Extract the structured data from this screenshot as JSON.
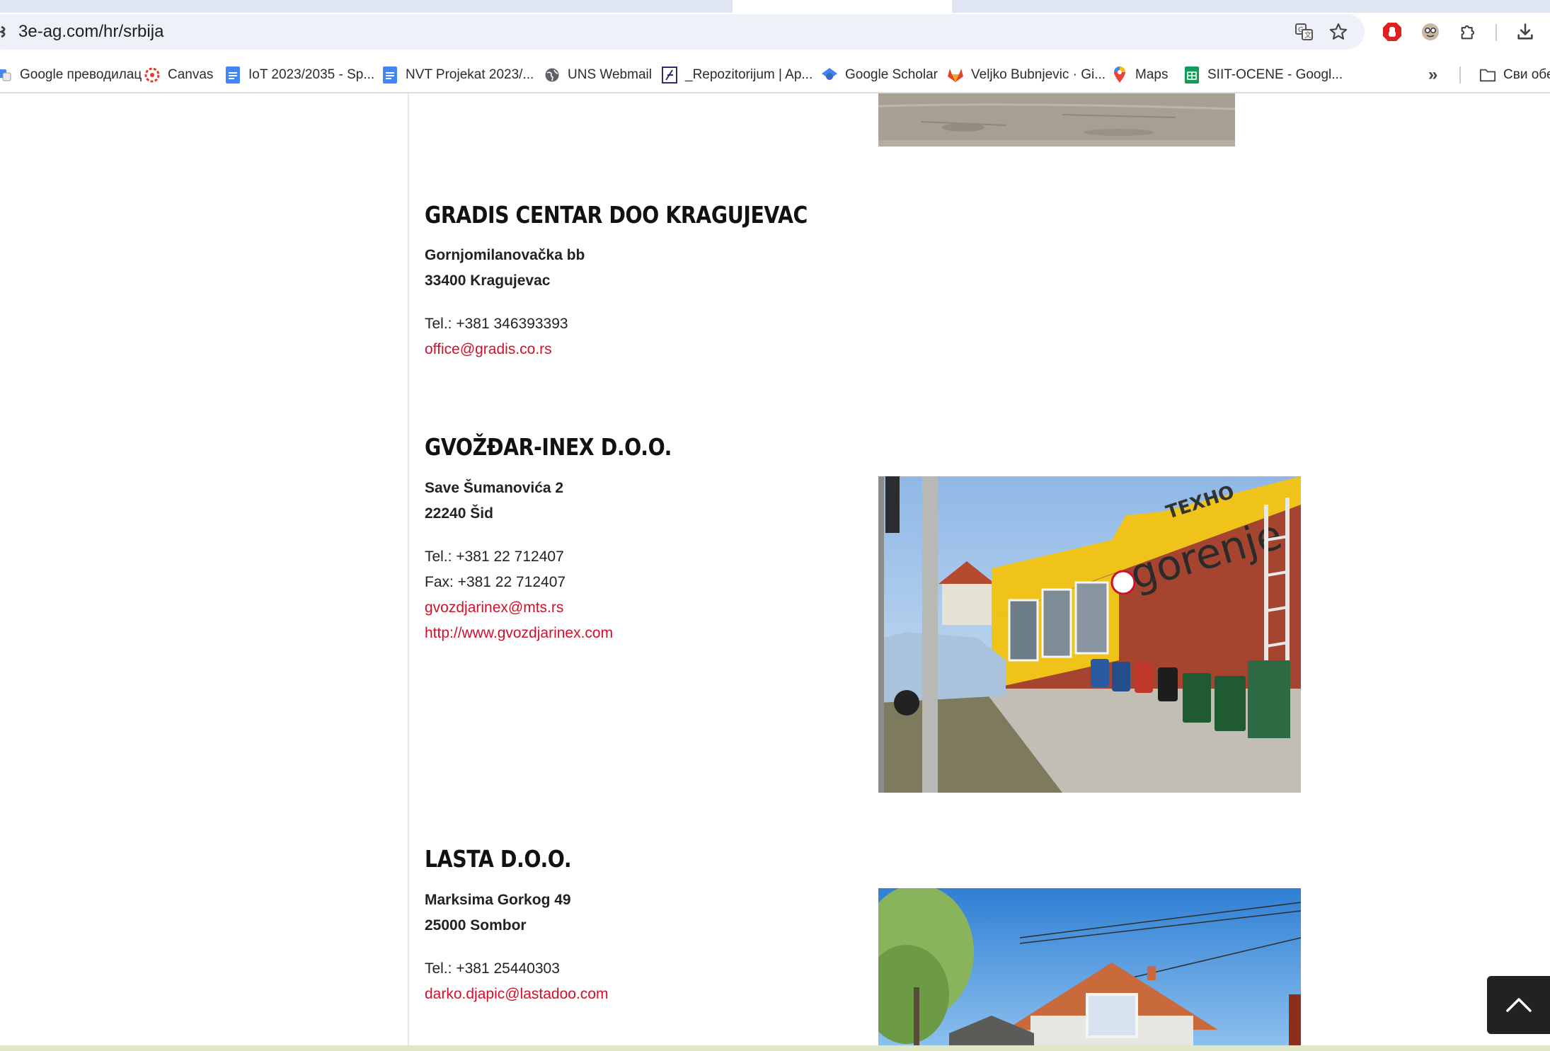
{
  "browser": {
    "url": "3e-ag.com/hr/srbija",
    "bookmarks": [
      {
        "label": "Google преводилац",
        "icon": "google-translate-icon"
      },
      {
        "label": "Canvas",
        "icon": "canvas-icon"
      },
      {
        "label": "IoT 2023/2035 - Sp...",
        "icon": "google-docs-icon"
      },
      {
        "label": "NVT Projekat 2023/...",
        "icon": "google-docs-icon"
      },
      {
        "label": "UNS Webmail",
        "icon": "globe-icon"
      },
      {
        "label": "_Repozitorijum | Ap...",
        "icon": "repository-icon"
      },
      {
        "label": "Google Scholar",
        "icon": "google-scholar-icon"
      },
      {
        "label": "Veljko Bubnjevic · Gi...",
        "icon": "gitlab-icon"
      },
      {
        "label": "Maps",
        "icon": "google-maps-icon"
      },
      {
        "label": "SIIT-OCENE - Googl...",
        "icon": "google-sheets-icon"
      }
    ],
    "overflow_label": "»",
    "all_bookmarks_label": "Сви обе"
  },
  "dealers": [
    {
      "name": "GRADIS CENTAR DOO KRAGUJEVAC",
      "street": "Gornjomilanovačka bb",
      "city": "33400 Kragujevac",
      "tel": "Tel.: +381 346393393",
      "email": "office@gradis.co.rs"
    },
    {
      "name": "GVOŽĐAR-INEX D.O.O.",
      "street": "Save Šumanovića 2",
      "city": "22240 Šid",
      "tel": "Tel.: +381 22 712407",
      "fax": "Fax: +381 22 712407",
      "email": "gvozdjarinex@mts.rs",
      "website": "http://www.gvozdjarinex.com",
      "photo_sign_text": "gorenje",
      "photo_banner_text": "TEXHO"
    },
    {
      "name": "LASTA D.O.O.",
      "street": "Marksima Gorkog 49",
      "city": "25000 Sombor",
      "tel": "Tel.: +381 25440303",
      "email": "darko.djapic@lastadoo.com"
    }
  ],
  "colors": {
    "link": "#d0112b",
    "scroll_button": "#222222"
  }
}
